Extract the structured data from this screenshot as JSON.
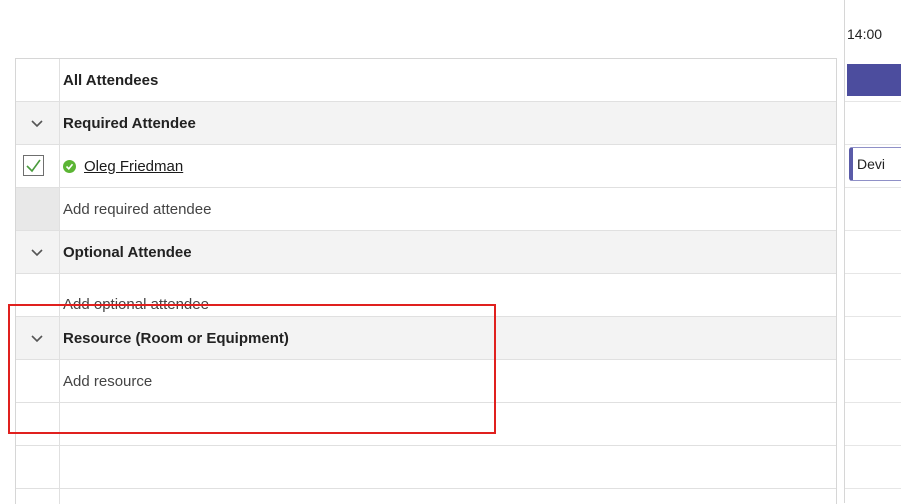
{
  "header": {
    "all_attendees": "All Attendees"
  },
  "groups": {
    "required": {
      "title": "Required Attendee",
      "attendees": [
        {
          "name": "Oleg Friedman",
          "status": "accepted"
        }
      ],
      "add_placeholder": "Add required attendee"
    },
    "optional": {
      "title": "Optional Attendee",
      "add_placeholder": "Add optional attendee"
    },
    "resource": {
      "title": "Resource (Room or Equipment)",
      "add_placeholder": "Add resource"
    }
  },
  "schedule": {
    "time_label": "14:00",
    "event_label": "Devi",
    "event_color": "#4c4d9e"
  },
  "colors": {
    "accepted": "#5bb534",
    "highlight": "#e0201e"
  }
}
